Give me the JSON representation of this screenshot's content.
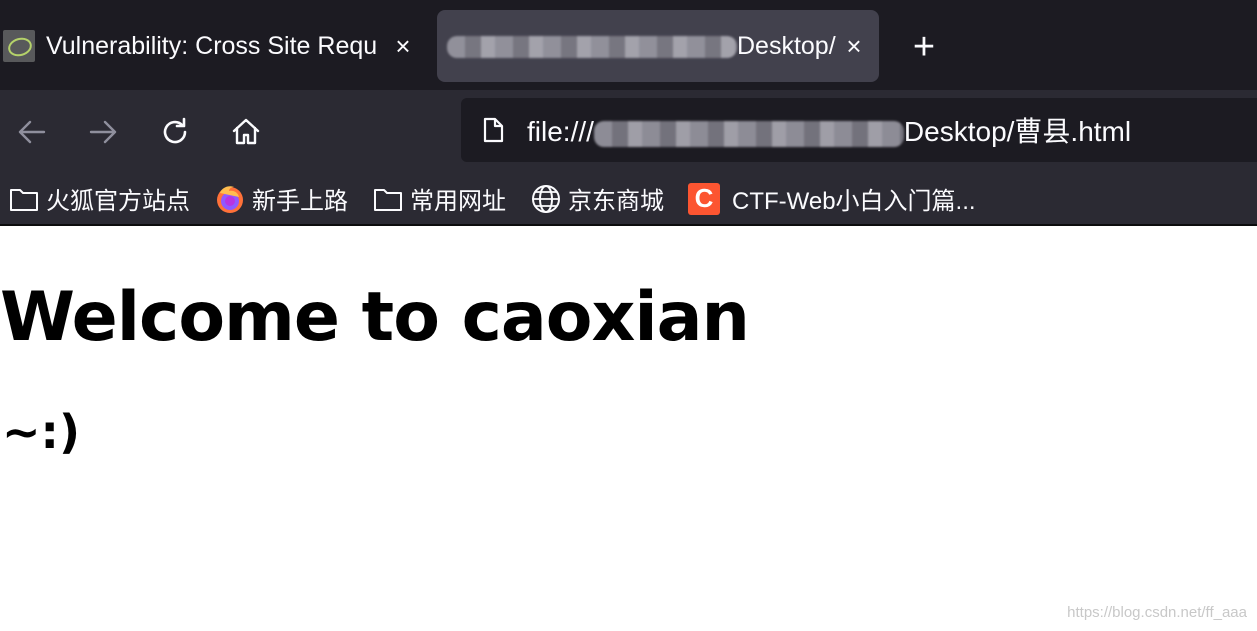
{
  "tabs": [
    {
      "title": "Vulnerability: Cross Site Requ",
      "active": false
    },
    {
      "title_prefix": "",
      "title_suffix": "Desktop/",
      "active": true
    }
  ],
  "toolbar": {
    "new_tab_label": "+",
    "close_label": "×"
  },
  "urlbar": {
    "prefix": "file:///",
    "suffix": "Desktop/曹县.html"
  },
  "bookmarks": [
    {
      "label": "火狐官方站点",
      "icon": "folder-icon"
    },
    {
      "label": "新手上路",
      "icon": "firefox-icon"
    },
    {
      "label": "常用网址",
      "icon": "folder-icon"
    },
    {
      "label": "京东商城",
      "icon": "globe-icon"
    },
    {
      "label": "CTF-Web小白入门篇...",
      "icon": "csdn-icon",
      "icon_text": "C"
    }
  ],
  "page": {
    "heading": "Welcome to caoxian",
    "subheading": "~:)"
  },
  "watermark": "https://blog.csdn.net/ff_aaa",
  "colors": {
    "titlebar": "#1c1b22",
    "toolbar": "#2b2a33",
    "active_tab": "#42414d",
    "csdn_brand": "#fc5531"
  }
}
